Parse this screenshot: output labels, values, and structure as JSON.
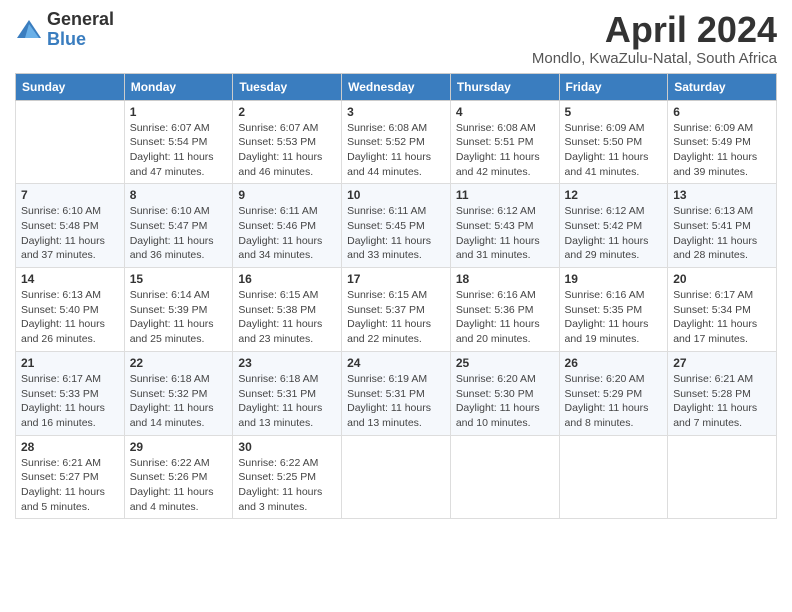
{
  "logo": {
    "general": "General",
    "blue": "Blue"
  },
  "title": "April 2024",
  "location": "Mondlo, KwaZulu-Natal, South Africa",
  "days_of_week": [
    "Sunday",
    "Monday",
    "Tuesday",
    "Wednesday",
    "Thursday",
    "Friday",
    "Saturday"
  ],
  "weeks": [
    [
      {
        "day": "",
        "info": ""
      },
      {
        "day": "1",
        "info": "Sunrise: 6:07 AM\nSunset: 5:54 PM\nDaylight: 11 hours and 47 minutes."
      },
      {
        "day": "2",
        "info": "Sunrise: 6:07 AM\nSunset: 5:53 PM\nDaylight: 11 hours and 46 minutes."
      },
      {
        "day": "3",
        "info": "Sunrise: 6:08 AM\nSunset: 5:52 PM\nDaylight: 11 hours and 44 minutes."
      },
      {
        "day": "4",
        "info": "Sunrise: 6:08 AM\nSunset: 5:51 PM\nDaylight: 11 hours and 42 minutes."
      },
      {
        "day": "5",
        "info": "Sunrise: 6:09 AM\nSunset: 5:50 PM\nDaylight: 11 hours and 41 minutes."
      },
      {
        "day": "6",
        "info": "Sunrise: 6:09 AM\nSunset: 5:49 PM\nDaylight: 11 hours and 39 minutes."
      }
    ],
    [
      {
        "day": "7",
        "info": "Sunrise: 6:10 AM\nSunset: 5:48 PM\nDaylight: 11 hours and 37 minutes."
      },
      {
        "day": "8",
        "info": "Sunrise: 6:10 AM\nSunset: 5:47 PM\nDaylight: 11 hours and 36 minutes."
      },
      {
        "day": "9",
        "info": "Sunrise: 6:11 AM\nSunset: 5:46 PM\nDaylight: 11 hours and 34 minutes."
      },
      {
        "day": "10",
        "info": "Sunrise: 6:11 AM\nSunset: 5:45 PM\nDaylight: 11 hours and 33 minutes."
      },
      {
        "day": "11",
        "info": "Sunrise: 6:12 AM\nSunset: 5:43 PM\nDaylight: 11 hours and 31 minutes."
      },
      {
        "day": "12",
        "info": "Sunrise: 6:12 AM\nSunset: 5:42 PM\nDaylight: 11 hours and 29 minutes."
      },
      {
        "day": "13",
        "info": "Sunrise: 6:13 AM\nSunset: 5:41 PM\nDaylight: 11 hours and 28 minutes."
      }
    ],
    [
      {
        "day": "14",
        "info": "Sunrise: 6:13 AM\nSunset: 5:40 PM\nDaylight: 11 hours and 26 minutes."
      },
      {
        "day": "15",
        "info": "Sunrise: 6:14 AM\nSunset: 5:39 PM\nDaylight: 11 hours and 25 minutes."
      },
      {
        "day": "16",
        "info": "Sunrise: 6:15 AM\nSunset: 5:38 PM\nDaylight: 11 hours and 23 minutes."
      },
      {
        "day": "17",
        "info": "Sunrise: 6:15 AM\nSunset: 5:37 PM\nDaylight: 11 hours and 22 minutes."
      },
      {
        "day": "18",
        "info": "Sunrise: 6:16 AM\nSunset: 5:36 PM\nDaylight: 11 hours and 20 minutes."
      },
      {
        "day": "19",
        "info": "Sunrise: 6:16 AM\nSunset: 5:35 PM\nDaylight: 11 hours and 19 minutes."
      },
      {
        "day": "20",
        "info": "Sunrise: 6:17 AM\nSunset: 5:34 PM\nDaylight: 11 hours and 17 minutes."
      }
    ],
    [
      {
        "day": "21",
        "info": "Sunrise: 6:17 AM\nSunset: 5:33 PM\nDaylight: 11 hours and 16 minutes."
      },
      {
        "day": "22",
        "info": "Sunrise: 6:18 AM\nSunset: 5:32 PM\nDaylight: 11 hours and 14 minutes."
      },
      {
        "day": "23",
        "info": "Sunrise: 6:18 AM\nSunset: 5:31 PM\nDaylight: 11 hours and 13 minutes."
      },
      {
        "day": "24",
        "info": "Sunrise: 6:19 AM\nSunset: 5:31 PM\nDaylight: 11 hours and 13 minutes."
      },
      {
        "day": "25",
        "info": "Sunrise: 6:20 AM\nSunset: 5:30 PM\nDaylight: 11 hours and 10 minutes."
      },
      {
        "day": "26",
        "info": "Sunrise: 6:20 AM\nSunset: 5:29 PM\nDaylight: 11 hours and 8 minutes."
      },
      {
        "day": "27",
        "info": "Sunrise: 6:21 AM\nSunset: 5:28 PM\nDaylight: 11 hours and 7 minutes."
      }
    ],
    [
      {
        "day": "28",
        "info": "Sunrise: 6:21 AM\nSunset: 5:27 PM\nDaylight: 11 hours and 5 minutes."
      },
      {
        "day": "29",
        "info": "Sunrise: 6:22 AM\nSunset: 5:26 PM\nDaylight: 11 hours and 4 minutes."
      },
      {
        "day": "30",
        "info": "Sunrise: 6:22 AM\nSunset: 5:25 PM\nDaylight: 11 hours and 3 minutes."
      },
      {
        "day": "",
        "info": ""
      },
      {
        "day": "",
        "info": ""
      },
      {
        "day": "",
        "info": ""
      },
      {
        "day": "",
        "info": ""
      }
    ]
  ]
}
